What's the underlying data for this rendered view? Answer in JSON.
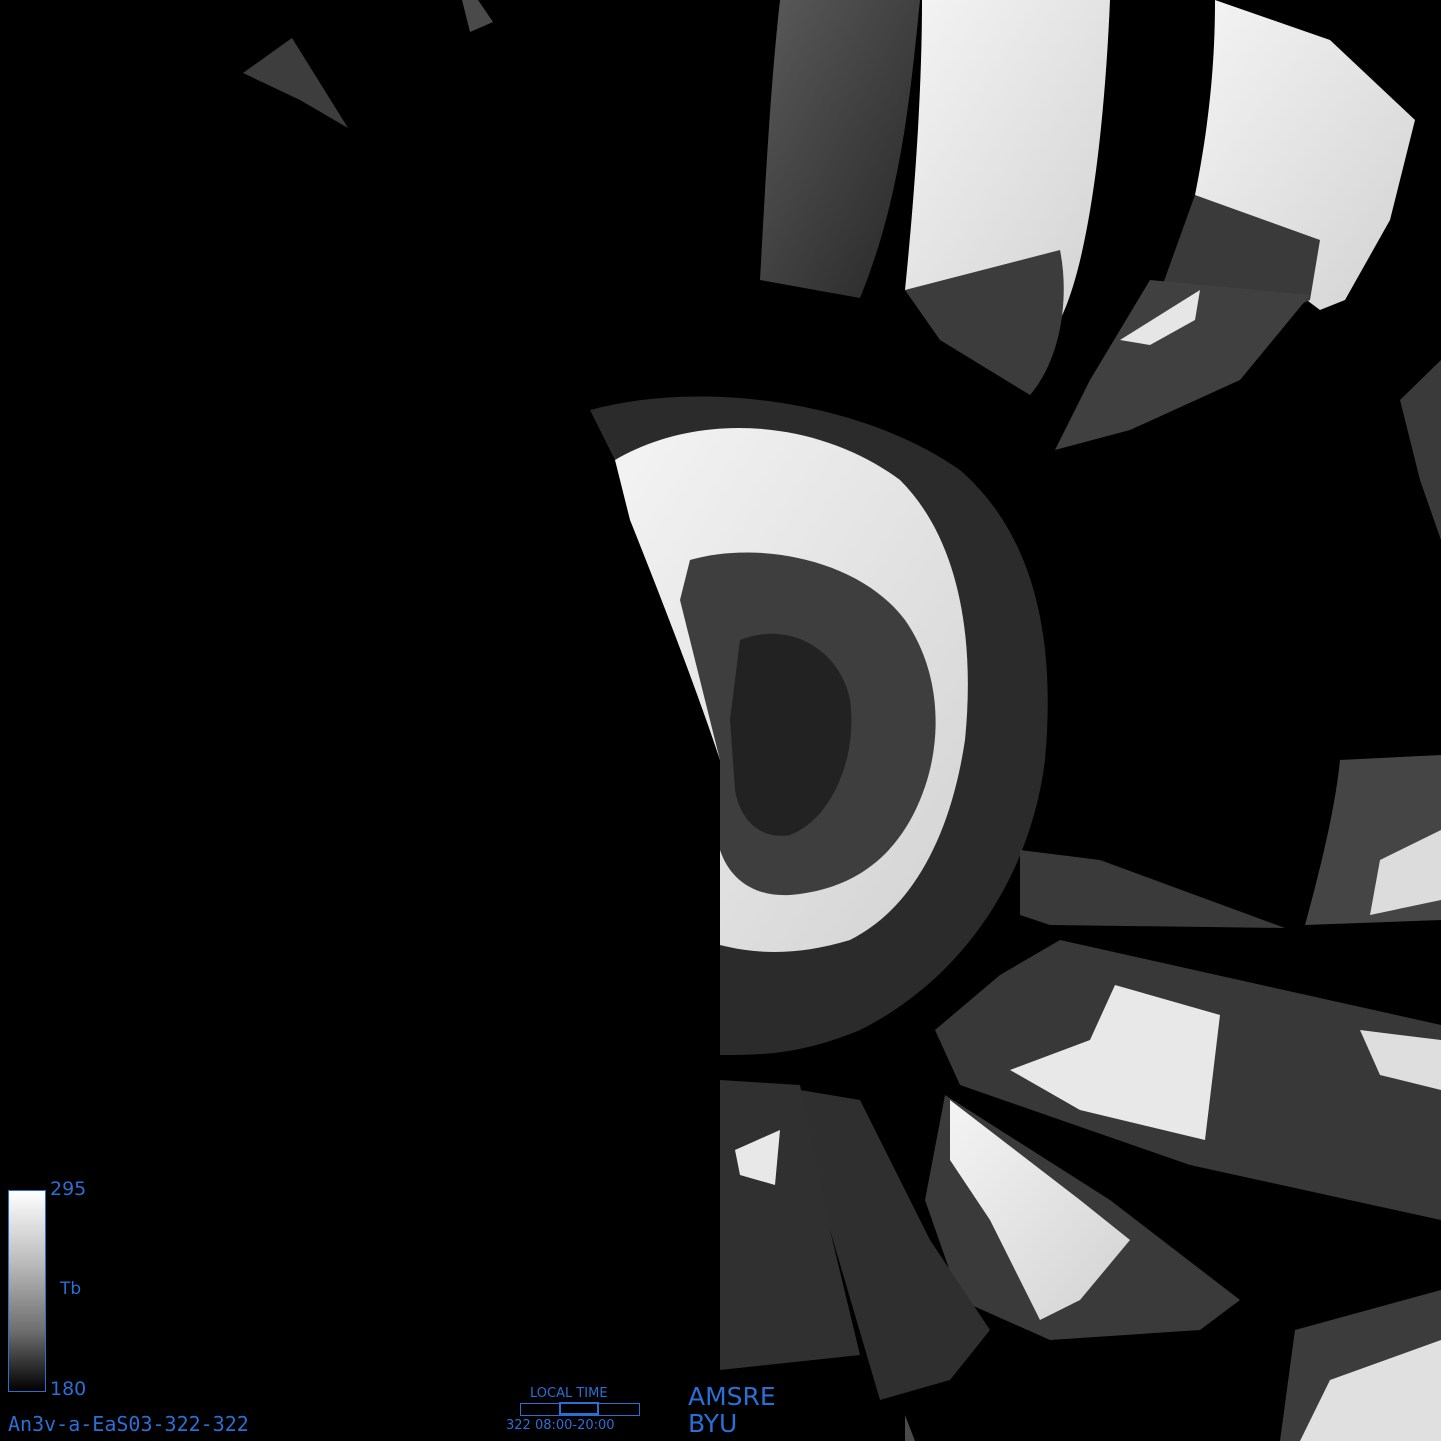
{
  "image_label": "An3v-a-EaS03-322-322",
  "colorbar": {
    "max": "295",
    "min": "180",
    "quantity": "Tb",
    "colors": {
      "top": "#ffffff",
      "bottom": "#000000",
      "frame": "#2a6fd6"
    }
  },
  "time_panel": {
    "title": "LOCAL TIME",
    "range": "322 08:00-20:00"
  },
  "credit": {
    "sensor": "AMSRE",
    "org": "BYU"
  },
  "accent_color": "#2a6fd6"
}
